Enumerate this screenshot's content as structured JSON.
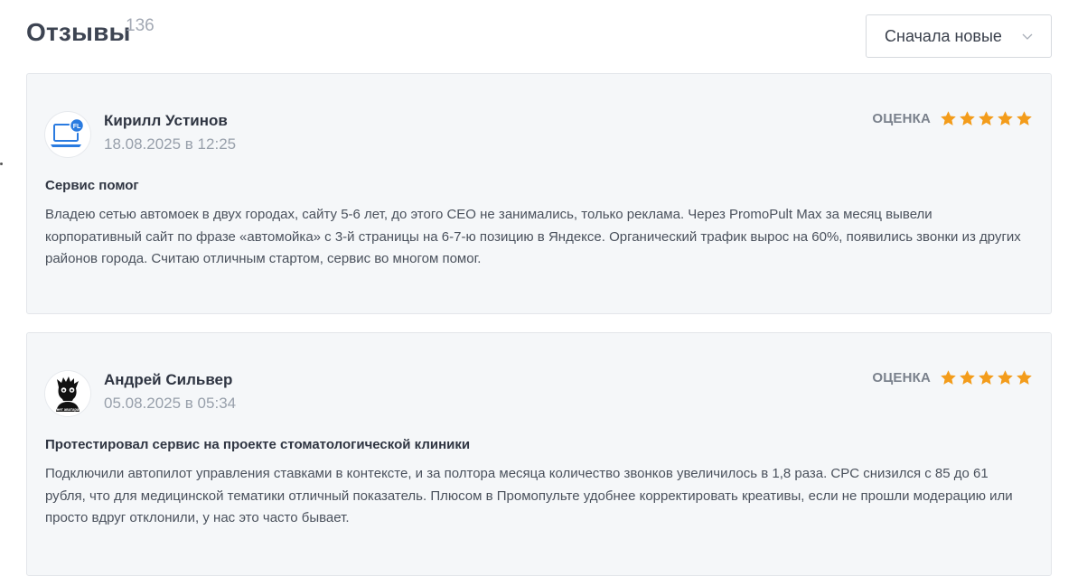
{
  "header": {
    "title": "Отзывы",
    "count": "136",
    "sort_label": "Сначала новые"
  },
  "colors": {
    "star": "#f39c1b",
    "card_bg": "#f5f7f9",
    "muted": "#98a0ab"
  },
  "reviews": [
    {
      "author": "Кирилл Устинов",
      "date": "18.08.2025 в 12:25",
      "rating_label": "ОЦЕНКА",
      "rating": 5,
      "title": "Сервис помог",
      "text": "Владею сетью автомоек в двух городах, сайту 5-6 лет, до этого СЕО не занимались, только реклама. Через PromoPult Max за месяц вывели корпоративный сайт по фразе «автомойка» с 3-й страницы на 6-7-ю позицию в Яндексе. Органический трафик вырос на 60%, появились звонки из других районов города. Считаю отличным стартом, сервис во многом помог.",
      "avatar_icon": "laptop-fl-icon",
      "avatar_text": "FL"
    },
    {
      "author": "Андрей Сильвер",
      "date": "05.08.2025 в 05:34",
      "rating_label": "ОЦЕНКА",
      "rating": 5,
      "title": "Протестировал сервис на проекте стоматологической клиники",
      "text": "Подключили автопилот управления ставками в контексте, и за полтора месяца количество звонков увеличилось в 1,8 раза. CPC снизился с 85 до 61 рубля, что для медицинской тематики отличный показатель. Плюсом в Промопульте удобнее корректировать креативы, если не прошли модерацию или просто вдруг отклонили, у нас это часто бывает.",
      "avatar_icon": "silhouette-avatar-icon",
      "avatar_text": "нет аватара"
    }
  ]
}
